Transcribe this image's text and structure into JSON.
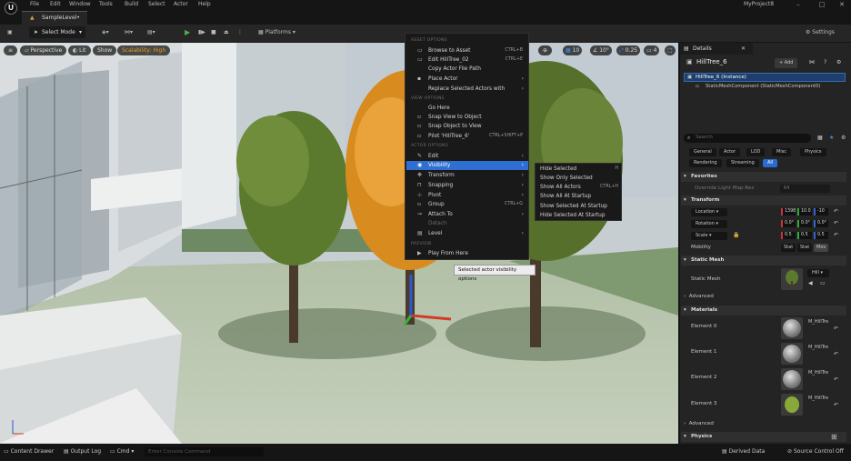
{
  "menubar": {
    "logo": "U",
    "items": [
      "File",
      "Edit",
      "Window",
      "Tools",
      "Build",
      "Select",
      "Actor",
      "Help"
    ],
    "project_name": "MyProject8"
  },
  "tabs": {
    "level_tab": "SampleLevel•"
  },
  "toolbar": {
    "select_mode": "Select Mode",
    "platforms": "Platforms",
    "settings": "Settings"
  },
  "viewport": {
    "perspective": "Perspective",
    "lit": "Lit",
    "show": "Show",
    "scalability": "Scalability: High",
    "snap_grid": "10",
    "snap_angle": "10°",
    "snap_scale": "0.25",
    "camera_speed": "4"
  },
  "context_menu": {
    "section_asset": "ASSET OPTIONS",
    "browse_to_asset": "Browse to Asset",
    "browse_shortcut": "CTRL+B",
    "edit_asset": "Edit HillTree_02",
    "edit_asset_shortcut": "CTRL+E",
    "copy_path": "Copy Actor File Path",
    "place_actor": "Place Actor",
    "replace_actors": "Replace Selected Actors with",
    "section_view": "VIEW OPTIONS",
    "go_here": "Go Here",
    "snap_view": "Snap View to Object",
    "snap_object": "Snap Object to View",
    "pilot": "Pilot 'HillTree_6'",
    "pilot_shortcut": "CTRL+SHIFT+P",
    "section_actor": "ACTOR OPTIONS",
    "edit": "Edit",
    "visibility": "Visibility",
    "transform": "Transform",
    "snapping": "Snapping",
    "pivot": "Pivot",
    "group": "Group",
    "group_shortcut": "CTRL+G",
    "attach_to": "Attach To",
    "detach": "Detach",
    "level": "Level",
    "section_preview": "PREVIEW",
    "play_from_here": "Play From Here"
  },
  "visibility_submenu": {
    "hide_selected": "Hide Selected",
    "hide_shortcut": "H",
    "show_only_selected": "Show Only Selected",
    "show_all_actors": "Show All Actors",
    "show_all_shortcut": "CTRL+H",
    "show_all_at_startup": "Show All At Startup",
    "show_selected_at_startup": "Show Selected At Startup",
    "hide_selected_at_startup": "Hide Selected At Startup"
  },
  "tooltip": "Selected actor visibility options",
  "details": {
    "tab": "Details",
    "actor_name": "HillTree_6",
    "add_button": "+ Add",
    "instance_row": "HillTree_6 (Instance)",
    "component_row": "StaticMeshComponent (StaticMeshComponent0)",
    "search_placeholder": "Search",
    "filters": [
      "General",
      "Actor",
      "LOD",
      "Misc",
      "Physics",
      "Rendering",
      "Streaming",
      "All"
    ],
    "favorites": "Favorites",
    "override_lightmap": "Override Light Map Res",
    "override_value": "64",
    "transform": "Transform",
    "location": "Location",
    "rotation": "Rotation",
    "scale": "Scale",
    "location_values": [
      "1398",
      "10.0",
      "-10"
    ],
    "rotation_values": [
      "0.0°",
      "0.0°",
      "0.0°"
    ],
    "scale_values": [
      "0.5",
      "0.5",
      "0.5"
    ],
    "mobility": "Mobility",
    "mobility_options": [
      "Stat",
      "Stat",
      "Mov"
    ],
    "static_mesh_section": "Static Mesh",
    "static_mesh_label": "Static Mesh",
    "static_mesh_value": "Hill",
    "advanced": "Advanced",
    "materials": "Materials",
    "elements": [
      {
        "label": "Element 0",
        "value": "M_HillTre"
      },
      {
        "label": "Element 1",
        "value": "M_HillTre"
      },
      {
        "label": "Element 2",
        "value": "M_HillTre"
      },
      {
        "label": "Element 3",
        "value": "M_HillTre"
      }
    ],
    "advanced2": "Advanced",
    "physics": "Physics"
  },
  "statusbar": {
    "content_drawer": "Content Drawer",
    "output_log": "Output Log",
    "cmd": "Cmd",
    "console_placeholder": "Enter Console Command",
    "derived_data": "Derived Data",
    "source_control": "Source Control Off"
  }
}
